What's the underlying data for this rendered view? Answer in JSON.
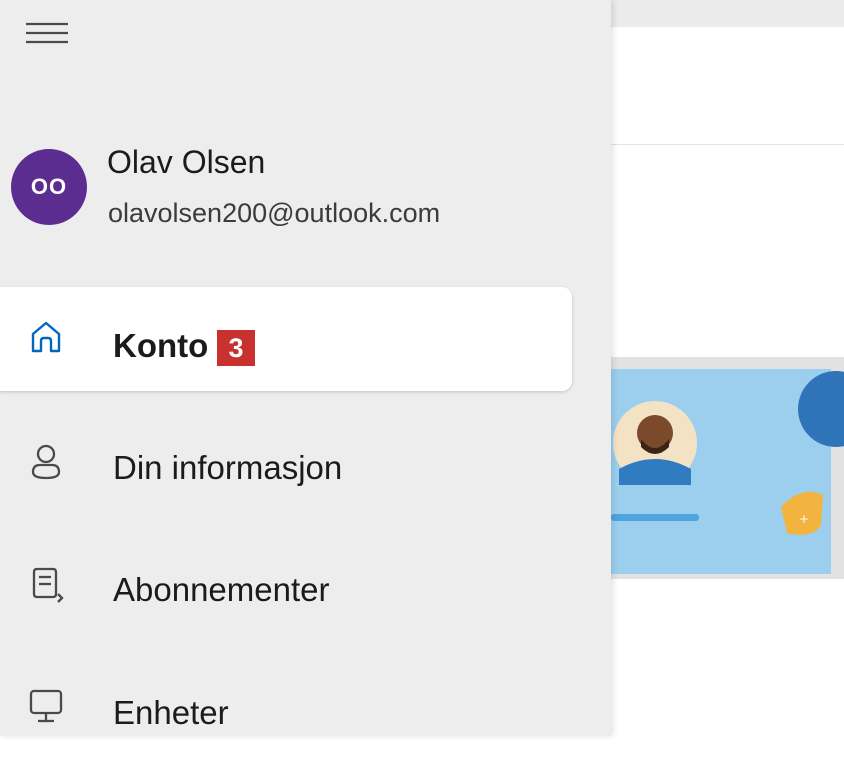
{
  "user": {
    "initials": "OO",
    "name": "Olav Olsen",
    "email": "olavolsen200@outlook.com"
  },
  "nav": {
    "items": [
      {
        "label": "Konto",
        "icon": "home-icon",
        "active": true
      },
      {
        "label": "Din informasjon",
        "icon": "person-icon",
        "active": false
      },
      {
        "label": "Abonnementer",
        "icon": "subscriptions-icon",
        "active": false
      },
      {
        "label": "Enheter",
        "icon": "monitor-icon",
        "active": false
      }
    ]
  },
  "annotation": {
    "step_number": "3"
  },
  "colors": {
    "avatar_bg": "#5c2d91",
    "active_icon": "#0067c0",
    "badge": "#c8312d",
    "sidebar_bg": "#ededed",
    "hero_bg": "#9ccfee"
  }
}
